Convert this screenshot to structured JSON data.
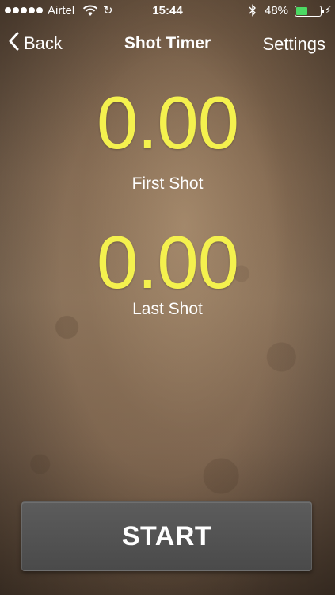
{
  "status_bar": {
    "carrier": "Airtel",
    "time": "15:44",
    "battery_percent": "48%",
    "battery_level": 0.48,
    "battery_color": "#4cd964",
    "icons": [
      "signal-dots-icon",
      "wifi-icon",
      "sync-icon",
      "bluetooth-icon",
      "battery-icon",
      "charging-icon"
    ]
  },
  "nav": {
    "back_label": "Back",
    "title": "Shot Timer",
    "settings_label": "Settings"
  },
  "timers": {
    "first_shot": {
      "value": "0.00",
      "label": "First Shot"
    },
    "last_shot": {
      "value": "0.00",
      "label": "Last Shot"
    },
    "value_color": "#f4f14e"
  },
  "controls": {
    "start_label": "START"
  }
}
